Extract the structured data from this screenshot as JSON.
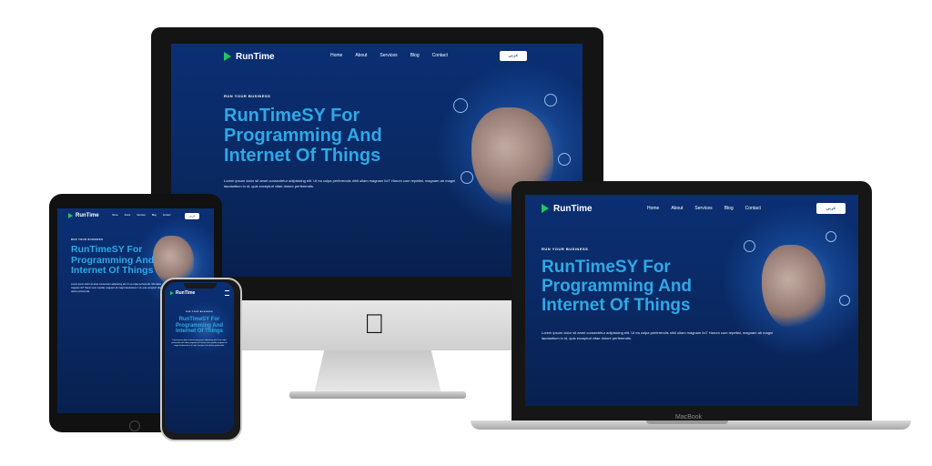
{
  "site": {
    "brand": "RunTime",
    "nav": [
      "Home",
      "About",
      "Services",
      "Blog",
      "Contact"
    ],
    "lang_button": "عربي",
    "tagline": "RUN YOUR BUSINESS",
    "headline_lines": [
      "RunTimeSY For",
      "Programming And",
      "Internet Of Things"
    ],
    "paragraph": "Lorem ipsum dolor sit amet consectetur adipisicing elit. Ut ea culpa perferendis nihil ullam magnam iloT Harum cum repellat, magnam ab magni laudantium in id, quis excepturi vitae dolore perferendis."
  },
  "devices": {
    "laptop_label": "MacBook"
  },
  "colors": {
    "site_bg": "#0a2a66",
    "headline": "#2fa8e6",
    "logo_accent": "#22c55e"
  }
}
